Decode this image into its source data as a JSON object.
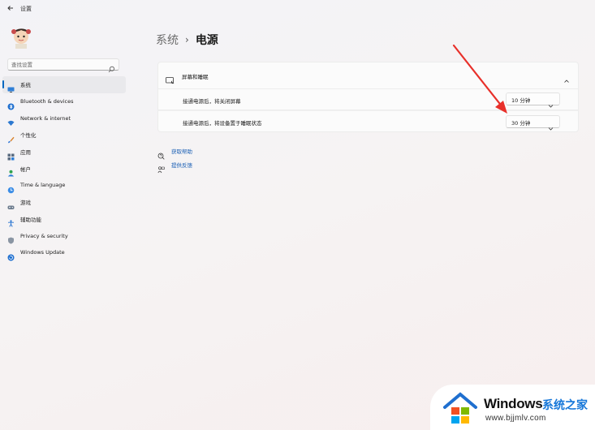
{
  "window": {
    "title": "设置"
  },
  "search": {
    "placeholder": "查找设置"
  },
  "sidebar": {
    "items": [
      {
        "label": "系统",
        "icon": "display-icon",
        "active": true
      },
      {
        "label": "Bluetooth & devices",
        "icon": "bluetooth-icon"
      },
      {
        "label": "Network & internet",
        "icon": "wifi-icon"
      },
      {
        "label": "个性化",
        "icon": "brush-icon"
      },
      {
        "label": "应用",
        "icon": "apps-icon"
      },
      {
        "label": "帐户",
        "icon": "account-icon"
      },
      {
        "label": "Time & language",
        "icon": "globe-clock-icon"
      },
      {
        "label": "游戏",
        "icon": "gamepad-icon"
      },
      {
        "label": "辅助功能",
        "icon": "accessibility-icon"
      },
      {
        "label": "Privacy & security",
        "icon": "shield-icon"
      },
      {
        "label": "Windows Update",
        "icon": "update-icon"
      }
    ]
  },
  "breadcrumb": {
    "parent": "系统",
    "separator": "›",
    "current": "电源"
  },
  "power": {
    "section_title": "屏幕和睡眠",
    "rows": [
      {
        "label": "接通电源后，将关闭屏幕",
        "value": "10 分钟"
      },
      {
        "label": "接通电源后，将设备置于睡眠状态",
        "value": "30 分钟"
      }
    ]
  },
  "links": [
    {
      "label": "获取帮助",
      "icon": "help-icon"
    },
    {
      "label": "提供反馈",
      "icon": "feedback-icon"
    }
  ],
  "watermark": {
    "brand": "Windows",
    "brand_cn": "系统之家",
    "url": "www.bjjmlv.com"
  },
  "colors": {
    "accent": "#0067c0",
    "annotation_arrow": "#e8302a",
    "link": "#1a5fb4"
  }
}
